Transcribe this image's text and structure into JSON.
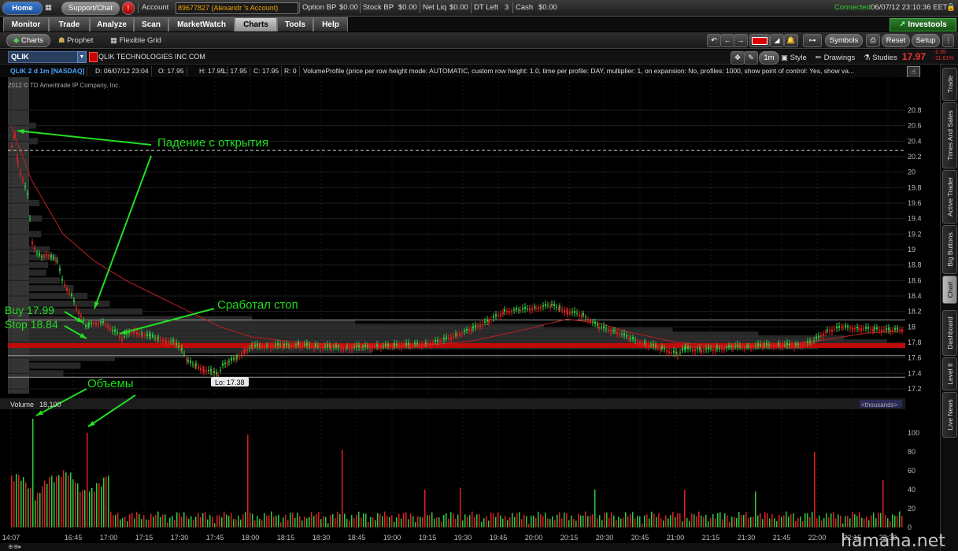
{
  "topbar": {
    "home": "Home",
    "support": "Support/Chat",
    "alert_glyph": "!",
    "account_label": "Account",
    "account_value": "89677827 (Alexandr 's Account)",
    "option_bp_label": "Option BP",
    "option_bp": "$0.00",
    "stock_bp_label": "Stock BP",
    "stock_bp": "$0.00",
    "net_liq_label": "Net Liq",
    "net_liq": "$0.00",
    "dt_left_label": "DT Left",
    "dt_left": "3",
    "cash_label": "Cash",
    "cash": "$0.00",
    "connected": "Connected",
    "datetime": "06/07/12 23:10:36 EET"
  },
  "tabs": [
    "Monitor",
    "Trade",
    "Analyze",
    "Scan",
    "MarketWatch",
    "Charts",
    "Tools",
    "Help"
  ],
  "active_tab": "Charts",
  "investools": "Investools",
  "subbar": {
    "charts": "Charts",
    "prophet": "Prophet",
    "flexible_grid": "Flexible Grid",
    "symbols": "Symbols",
    "reset": "Reset",
    "setup": "Setup"
  },
  "symrow": {
    "symbol": "QLIK",
    "company": "QLIK TECHNOLOGIES INC COM",
    "period": "1m",
    "style": "Style",
    "drawings": "Drawings",
    "studies": "Studies",
    "last": "17.97",
    "chg1": "-2.35",
    "chg2": "-11.61%"
  },
  "info": {
    "symbol": "QLIK 2 d 1m [NASDAQ]",
    "date": "D: 06/07/12 23:04",
    "open": "O: 17.95",
    "high": "H: 17.95",
    "low": "L: 17.95",
    "close": "C: 17.95",
    "range": "R: 0",
    "study": "VolumeProfile (price per row height mode: AUTOMATIC, custom row height: 1.0, time per profile: DAY, multiplier: 1, on expansion: No, profiles: 1000, show point of control: Yes, show va..."
  },
  "copyright": "2012 © TD Ameritrade IP Company, Inc.",
  "price_axis": {
    "ticks": [
      "20.8",
      "20.6",
      "20.4",
      "20.2",
      "20",
      "19.8",
      "19.6",
      "19.4",
      "19.2",
      "19",
      "18.8",
      "18.6",
      "18.4",
      "18.2",
      "18",
      "17.8",
      "17.6",
      "17.4",
      "17.2"
    ],
    "levels": {
      "top_dashed": 20.28,
      "upper": 18.09,
      "last": 17.95,
      "poc": 17.76,
      "lower": 17.35
    }
  },
  "time_axis": [
    "14:07",
    "16:45",
    "17:00",
    "17:15",
    "17:30",
    "17:45",
    "18:00",
    "18:15",
    "18:30",
    "18:45",
    "19:00",
    "19:15",
    "19:30",
    "19:45",
    "20:00",
    "20:15",
    "20:30",
    "20:45",
    "21:00",
    "21:15",
    "21:30",
    "21:45",
    "22:00",
    "22:15",
    "22:30"
  ],
  "low_label": "Lo: 17.38",
  "volume": {
    "label": "Volume",
    "value": "18,100",
    "unit": "<thousands>",
    "ticks": [
      "100",
      "80",
      "60",
      "40",
      "20",
      "0"
    ]
  },
  "annotations": {
    "drop": "Падение с  открытия",
    "buy": "Buy 17.99",
    "stop": "Stop 18.84",
    "stop_hit": "Сработал  стоп",
    "volumes": "Объемы"
  },
  "sidebar_tabs": [
    "Trade",
    "Times And Sales",
    "Active Trader",
    "Big Buttons",
    "Chart",
    "Dashboard",
    "Level II",
    "Live News"
  ],
  "active_sidebar": "Chart",
  "watermark": "hamaha.net",
  "colors": {
    "up": "#2ecc40",
    "down": "#e02020",
    "annotation": "#22dd22",
    "poc": "#d01010",
    "sma": "#cc2222"
  }
}
